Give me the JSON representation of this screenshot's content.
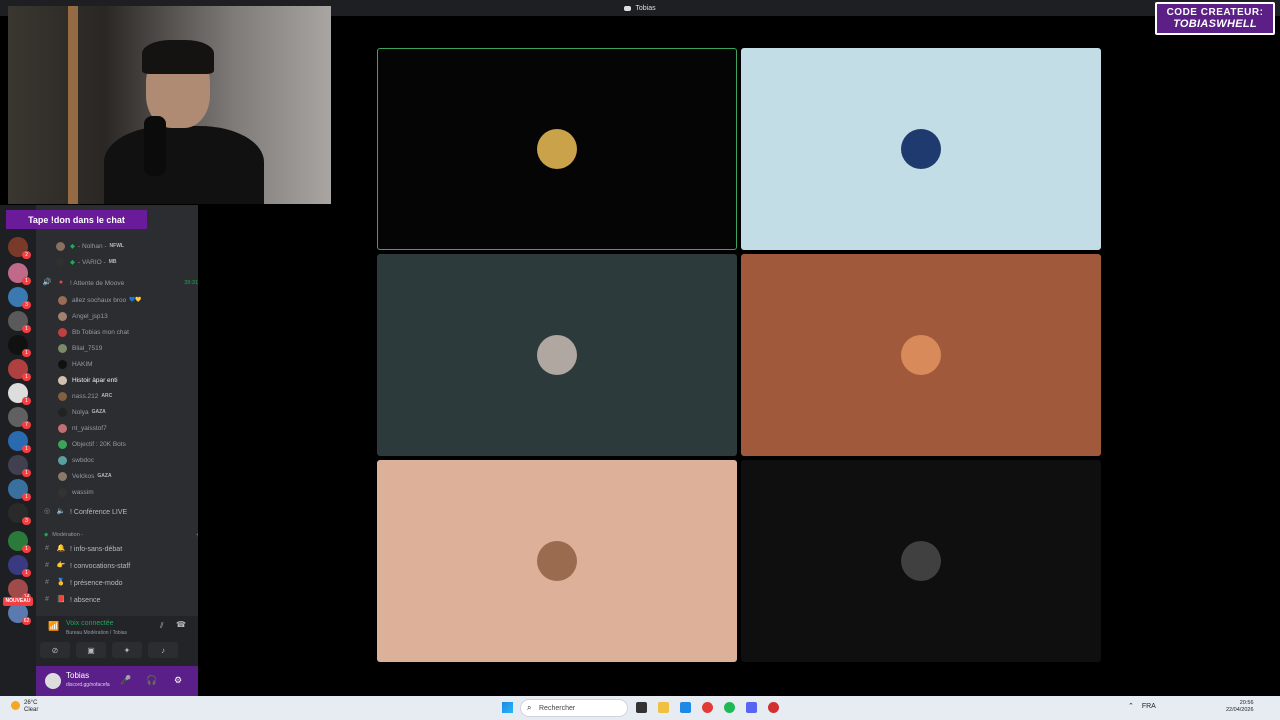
{
  "window": {
    "title": "Tobias"
  },
  "badge": {
    "line1": "CODE CREATEUR:",
    "line2": "TOBIASWHELL"
  },
  "promo": "Tape !don dans le chat",
  "sidebar": {
    "top_members": [
      {
        "name": "- Nolhan -",
        "tag": "NFWL",
        "tag_color": "#b5bac1"
      },
      {
        "name": "- VARIO -",
        "tag": "MB",
        "tag_color": "#b5bac1"
      }
    ],
    "voice_channel": {
      "name": "! Attente de Moove",
      "timer": "39:31"
    },
    "members": [
      {
        "name": "allez sochaux broo",
        "tag": "💙💛",
        "color": "#9a6b55"
      },
      {
        "name": "Angel_jsp13",
        "tag": "",
        "color": "#a08070"
      },
      {
        "name": "Bb Tobias mon chat",
        "tag": "",
        "color": "#c04040"
      },
      {
        "name": "Bilal_7519",
        "tag": "",
        "color": "#7a8a6a"
      },
      {
        "name": "HAKIM",
        "tag": "",
        "color": "#111111"
      },
      {
        "name": "Histoir àpar enti",
        "tag": "",
        "color": "#d0c0b0",
        "highlight": true
      },
      {
        "name": "nass.212",
        "tag": "ARC",
        "color": "#806040"
      },
      {
        "name": "Nolya",
        "tag": "GAZA",
        "color": "#222222"
      },
      {
        "name": "nt_yaisstof7",
        "tag": "",
        "color": "#c07070"
      },
      {
        "name": "Objectif : 20K Bots",
        "tag": "",
        "color": "#3ba55c"
      },
      {
        "name": "swbdoc",
        "tag": "",
        "color": "#5aa0a0"
      },
      {
        "name": "Velckos",
        "tag": "GAZA",
        "color": "#8a7a6a"
      },
      {
        "name": "wassim",
        "tag": "",
        "color": "#333333"
      }
    ],
    "channels": [
      {
        "name": "! Conférence LIVE",
        "type": "voice"
      }
    ],
    "category": "Modération -",
    "text_channels": [
      {
        "name": "! info-sans-débat",
        "emoji": "🔔"
      },
      {
        "name": "! convocations-staff",
        "emoji": "👉"
      },
      {
        "name": "! présence-modo",
        "emoji": "🥇"
      },
      {
        "name": "! absence",
        "emoji": "📕"
      }
    ],
    "voice_status": "Voix connectée",
    "voice_location": "Bureau Modération / Tobias",
    "user": {
      "name": "Tobias",
      "status": "discord.gg/nofacefa"
    },
    "server_badges": [
      "2",
      "1",
      "3",
      "1",
      "1",
      "1",
      "1",
      "7",
      "1",
      "1",
      "1",
      "3",
      "1",
      "1",
      "14",
      "62"
    ],
    "nouveau": "NOUVEAU"
  },
  "taskbar": {
    "temp": "26°C",
    "weather": "Clear",
    "search_placeholder": "Rechercher",
    "lang": "FRA",
    "time": "20:56",
    "date": "22/04/2026"
  },
  "tiles": [
    {
      "bg": "#050505",
      "avatar": "#caa24a",
      "speaking": true
    },
    {
      "bg": "#c3dde6",
      "avatar": "#1e3a6e",
      "speaking": false
    },
    {
      "bg": "#2c3a3b",
      "avatar": "#b0a8a0",
      "speaking": false
    },
    {
      "bg": "#a0593a",
      "avatar": "#d88a5a",
      "speaking": false
    },
    {
      "bg": "#ddb199",
      "avatar": "#9a6b4f",
      "speaking": false
    },
    {
      "bg": "#0f0f0f",
      "avatar": "#404040",
      "speaking": false
    }
  ]
}
